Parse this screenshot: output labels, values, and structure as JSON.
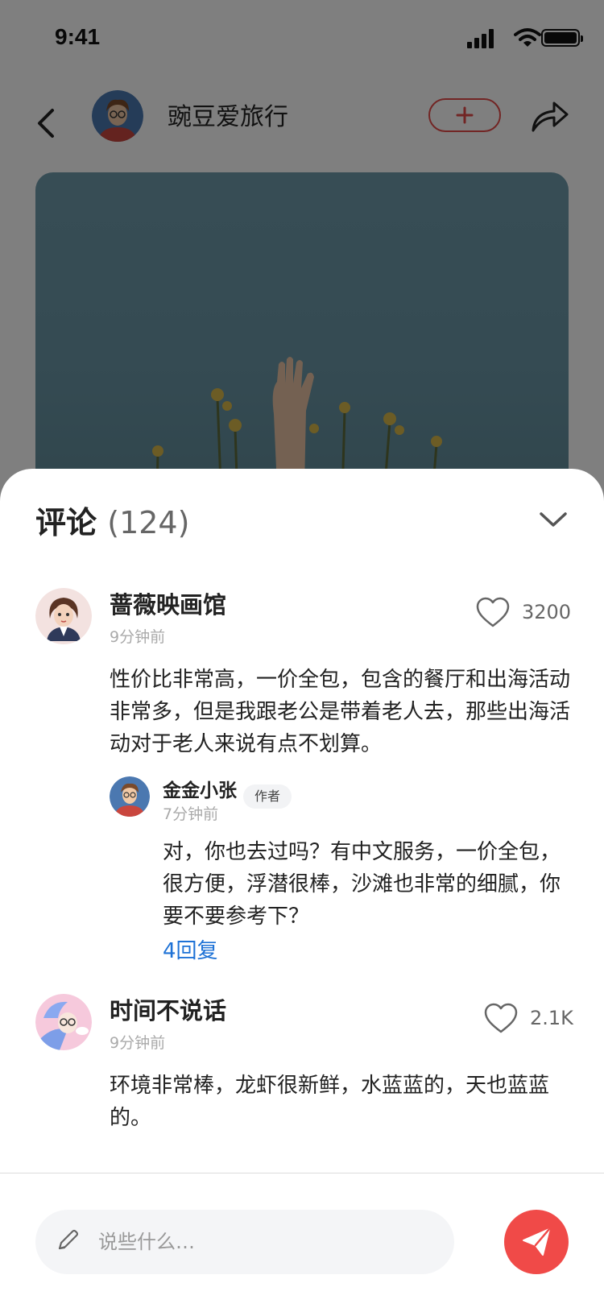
{
  "status_bar": {
    "time": "9:41"
  },
  "header": {
    "author_name": "豌豆爱旅行",
    "follow_label": "+"
  },
  "comments_panel": {
    "title": "评论",
    "count": "(124)",
    "comments": [
      {
        "username": "蔷薇映画馆",
        "time": "9分钟前",
        "likes": "3200",
        "text": "性价比非常高，一价全包，包含的餐厅和出海活动非常多，但是我跟老公是带着老人去，那些出海活动对于老人来说有点不划算。",
        "reply": {
          "username": "金金小张",
          "time": "7分钟前",
          "tag": "作者",
          "text": "对，你也去过吗？有中文服务，一价全包，很方便，浮潜很棒，沙滩也非常的细腻，你要不要参考下？",
          "replies_count": "4回复"
        }
      },
      {
        "username": "时间不说话",
        "time": "9分钟前",
        "likes": "2.1K",
        "text": "环境非常棒，龙虾很新鲜，水蓝蓝的，天也蓝蓝的。"
      }
    ]
  },
  "composer": {
    "placeholder": "说些什么…"
  },
  "colors": {
    "accent": "#f04a48",
    "link": "#1e72d6",
    "overlay": "rgba(0,0,0,0.5)"
  },
  "icons": [
    "back-arrow-icon",
    "plus-icon",
    "share-icon",
    "chevron-down-icon",
    "heart-icon",
    "pencil-icon",
    "send-icon"
  ]
}
